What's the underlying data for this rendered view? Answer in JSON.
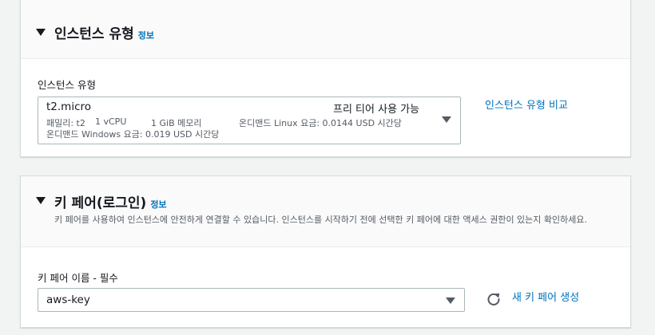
{
  "instance_type_panel": {
    "title": "인스턴스 유형",
    "info": "정보",
    "field_label": "인스턴스 유형",
    "selected": {
      "name": "t2.micro",
      "free_tier": "프리 티어 사용 가능",
      "family": "패밀리: t2",
      "vcpu": "1 vCPU",
      "memory": "1 GiB 메모리",
      "linux_price": "온디맨드 Linux 요금: 0.0144 USD 시간당",
      "windows_price": "온디맨드 Windows 요금: 0.019 USD 시간당"
    },
    "compare_link": "인스턴스 유형 비교"
  },
  "key_pair_panel": {
    "title": "키 페어(로그인)",
    "info": "정보",
    "description": "키 페어를 사용하여 인스턴스에 안전하게 연결할 수 있습니다. 인스턴스를 시작하기 전에 선택한 키 페어에 대한 액세스 권한이 있는지 확인하세요.",
    "field_label": "키 페어 이름 - 필수",
    "selected_value": "aws-key",
    "refresh_icon": "refresh-icon",
    "create_link": "새 키 페어 생성"
  },
  "colors": {
    "link": "#0073bb",
    "header_bg": "#fafafa",
    "page_bg": "#f2f3f3",
    "border": "#aab7b8"
  }
}
